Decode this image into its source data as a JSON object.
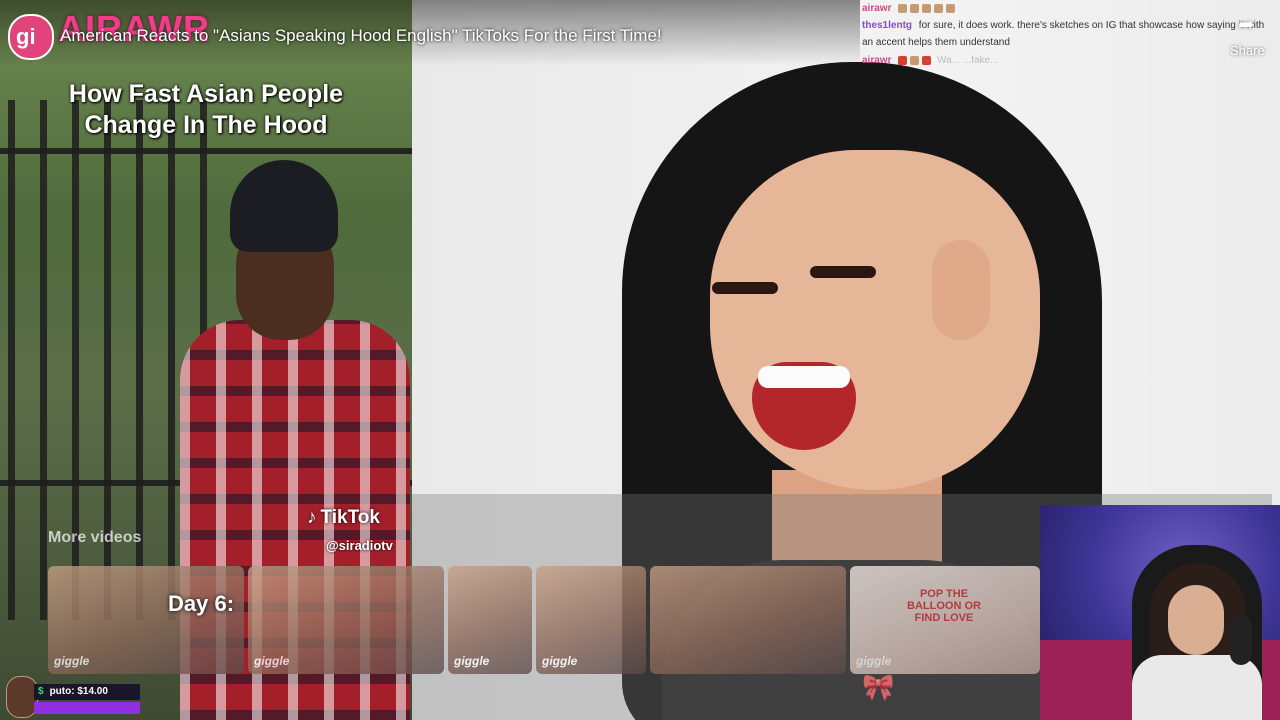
{
  "stream": {
    "channel_logo_text": "AIRAWR",
    "channel_avatar_text": "gi",
    "video_title": "American Reacts to \"Asians Speaking Hood English\" TikToks For the First Time!",
    "share_label": "Share",
    "share_icon": "share-arrow-icon"
  },
  "left_clip": {
    "caption": "How Fast Asian People Change In The Hood",
    "tiktok_brand": "TikTok",
    "tiktok_handle": "@siradiotv"
  },
  "chat": {
    "lines": [
      {
        "user": "airawr",
        "message": ""
      },
      {
        "user": "thes1lentg",
        "message": "for sure, it does work. there's sketches on IG that showcase how saying it with an accent helps them understand"
      },
      {
        "user": "airawr",
        "message": "Wa... ...fake..."
      }
    ]
  },
  "more_videos": {
    "label": "More videos",
    "thumbnails": [
      {
        "tag": "giggle",
        "red_text": ""
      },
      {
        "tag": "giggle",
        "red_text": ""
      },
      {
        "tag": "giggle",
        "red_text": ""
      },
      {
        "tag": "giggle",
        "red_text": ""
      },
      {
        "tag": "",
        "red_text": ""
      },
      {
        "tag": "giggle",
        "red_text": "POP THE BALLOON OR FIND LOVE"
      }
    ]
  },
  "overlay_text": {
    "day_label": "Day 6:"
  },
  "donation": {
    "name": "puto",
    "amount": "$14.00",
    "currency_symbol": "$"
  },
  "colors": {
    "brand_pink": "#f53c8c",
    "chat_user_purple": "#8a49c8",
    "donation_bar": "#8f2fe0",
    "donation_dollar_green": "#3fd86a"
  }
}
